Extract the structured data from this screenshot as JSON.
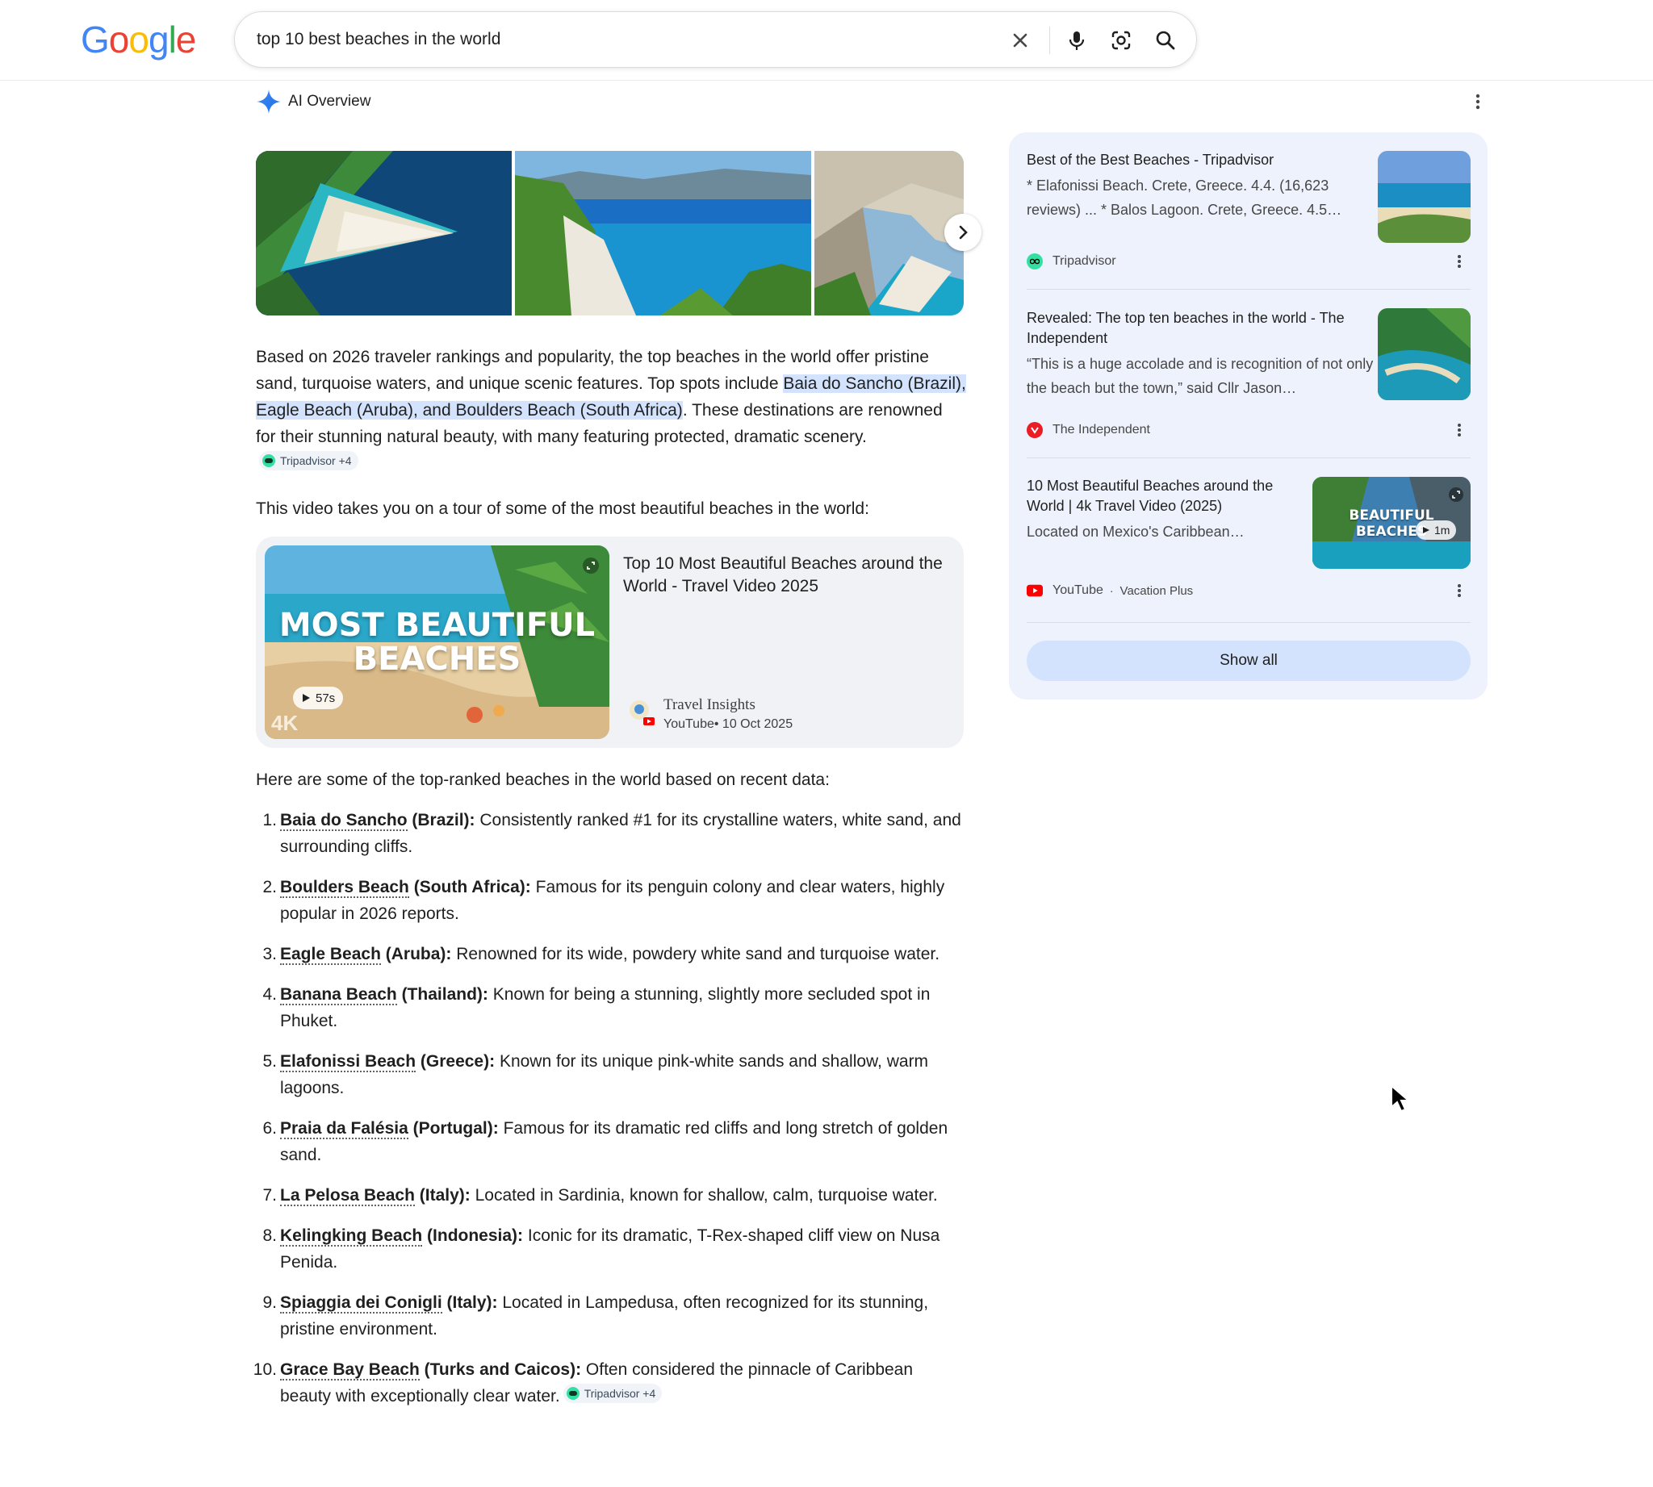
{
  "header": {
    "logo_letters": [
      {
        "ch": "G",
        "color": "#4285F4"
      },
      {
        "ch": "o",
        "color": "#EA4335"
      },
      {
        "ch": "o",
        "color": "#FBBC05"
      },
      {
        "ch": "g",
        "color": "#4285F4"
      },
      {
        "ch": "l",
        "color": "#34A853"
      },
      {
        "ch": "e",
        "color": "#EA4335"
      }
    ],
    "search_query": "top 10 best beaches in the world",
    "icons": [
      "close-icon",
      "microphone-icon",
      "lens-icon",
      "search-icon"
    ]
  },
  "ai_overview": {
    "label": "AI Overview",
    "intro": {
      "part1": "Based on 2026 traveler rankings and popularity, the top beaches in the world offer pristine sand, turquoise waters, and unique scenic features. Top spots include ",
      "highlight": "Baia do Sancho (Brazil), Eagle Beach (Aruba), and Boulders Beach (South Africa)",
      "part2": ". These destinations are renowned for their stunning natural beauty, with many featuring protected, dramatic scenery.",
      "chip": "Tripadvisor +4"
    },
    "video_intro": "This video takes you on a tour of some of the most beautiful beaches in the world:",
    "video": {
      "title": "Top 10 Most Beautiful Beaches around the World - Travel Video 2025",
      "thumb_text_line1": "MOST BEAUTIFUL",
      "thumb_text_line2": "BEACHES",
      "duration": "57s",
      "channel": "Travel Insights",
      "meta": "YouTube• 10 Oct 2025",
      "corner_badge": "4K"
    },
    "list_intro": "Here are some of the top-ranked beaches in the world based on recent data:",
    "list": [
      {
        "n": "1.",
        "name": "Baia do Sancho",
        "suffix": " (Brazil):",
        "desc": " Consistently ranked #1 for its crystalline waters, white sand, and surrounding cliffs."
      },
      {
        "n": "2.",
        "name": "Boulders Beach",
        "suffix": " (South Africa):",
        "desc": " Famous for its penguin colony and clear waters, highly popular in 2026 reports."
      },
      {
        "n": "3.",
        "name": "Eagle Beach",
        "suffix": " (Aruba):",
        "desc": " Renowned for its wide, powdery white sand and turquoise water."
      },
      {
        "n": "4.",
        "name": "Banana Beach",
        "suffix": " (Thailand):",
        "desc": " Known for being a stunning, slightly more secluded spot in Phuket."
      },
      {
        "n": "5.",
        "name": "Elafonissi Beach",
        "suffix": " (Greece):",
        "desc": " Known for its unique pink-white sands and shallow, warm lagoons."
      },
      {
        "n": "6.",
        "name": "Praia da Falésia",
        "suffix": " (Portugal):",
        "desc": " Famous for its dramatic red cliffs and long stretch of golden sand."
      },
      {
        "n": "7.",
        "name": "La Pelosa Beach",
        "suffix": " (Italy):",
        "desc": " Located in Sardinia, known for shallow, calm, turquoise water."
      },
      {
        "n": "8.",
        "name": "Kelingking Beach",
        "suffix": " (Indonesia):",
        "desc": " Iconic for its dramatic, T-Rex-shaped cliff view on Nusa Penida."
      },
      {
        "n": "9.",
        "name": "Spiaggia dei Conigli",
        "suffix": " (Italy):",
        "desc": " Located in Lampedusa, often recognized for its stunning, pristine environment."
      },
      {
        "n": "10.",
        "name": "Grace Bay Beach",
        "suffix": " (Turks and Caicos):",
        "desc": " Often considered the pinnacle of Caribbean beauty with exceptionally clear water."
      }
    ],
    "list_chip": "Tripadvisor +4"
  },
  "sources": {
    "items": [
      {
        "title": "Best of the Best Beaches - Tripadvisor",
        "snippet": "* Elafonissi Beach. Crete, Greece. 4.4. (16,623 reviews) ... * Balos Lagoon. Crete, Greece. 4.5…",
        "site": "Tripadvisor"
      },
      {
        "title": "Revealed: The top ten beaches in the world - The Independent",
        "snippet": "“This is a huge accolade and is recognition of not only the beach but the town,” said Cllr Jason…",
        "site": "The Independent"
      },
      {
        "title": "10 Most Beautiful Beaches around the World | 4k Travel Video (2025)",
        "snippet": "Located on Mexico's Caribbean…",
        "site": "YouTube",
        "channel": "Vacation Plus",
        "separator": "·",
        "duration": "1m",
        "thumb_text": "BEAUTIFUL BEACHES"
      }
    ],
    "show_all": "Show all"
  }
}
